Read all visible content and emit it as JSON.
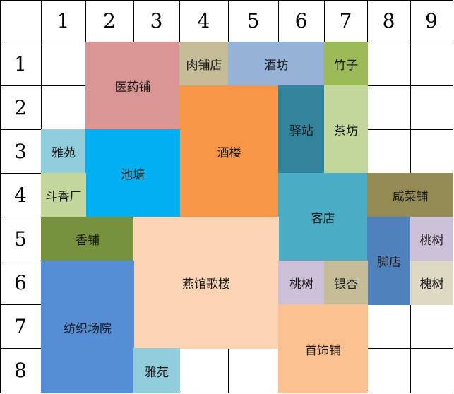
{
  "columns": [
    "1",
    "2",
    "3",
    "4",
    "5",
    "6",
    "7",
    "8",
    "9"
  ],
  "rows": [
    "1",
    "2",
    "3",
    "4",
    "5",
    "6",
    "7",
    "8"
  ],
  "cells": [
    {
      "id": "yiyaopu",
      "label": "医药铺",
      "color": "#d99694"
    },
    {
      "id": "roupudian",
      "label": "肉铺店",
      "color": "#c4bd97"
    },
    {
      "id": "jiufang",
      "label": "酒坊",
      "color": "#95b3d7"
    },
    {
      "id": "zhuzi",
      "label": "竹子",
      "color": "#9bbb59"
    },
    {
      "id": "jiulou",
      "label": "酒楼",
      "color": "#f79646"
    },
    {
      "id": "yizhan",
      "label": "驿站",
      "color": "#31849b"
    },
    {
      "id": "chafang",
      "label": "茶坊",
      "color": "#c3d69b"
    },
    {
      "id": "yayuan-1",
      "label": "雅苑",
      "color": "#92cddc"
    },
    {
      "id": "chitang",
      "label": "池塘",
      "color": "#00b0f0"
    },
    {
      "id": "douxiangchang",
      "label": "斗香厂",
      "color": "#c3d69b"
    },
    {
      "id": "kedian",
      "label": "客店",
      "color": "#4bacc6"
    },
    {
      "id": "xiancaipu",
      "label": "咸菜铺",
      "color": "#948a54"
    },
    {
      "id": "xiangpu",
      "label": "香铺",
      "color": "#76923c"
    },
    {
      "id": "yanguangelou",
      "label": "燕馆歌楼",
      "color": "#fbd4b4"
    },
    {
      "id": "jiaodian",
      "label": "脚店",
      "color": "#4f81bd"
    },
    {
      "id": "taoshu-1",
      "label": "桃树",
      "color": "#ccc1d9"
    },
    {
      "id": "taoshu-2",
      "label": "桃树",
      "color": "#ccc1d9"
    },
    {
      "id": "yinxing",
      "label": "银杏",
      "color": "#c4bd97"
    },
    {
      "id": "huaishu",
      "label": "槐树",
      "color": "#ddd9c3"
    },
    {
      "id": "fangzhichangyuan",
      "label": "纺织场院",
      "color": "#558ed5"
    },
    {
      "id": "shoushipu",
      "label": "首饰铺",
      "color": "#fac090"
    },
    {
      "id": "yayuan-2",
      "label": "雅苑",
      "color": "#92cddc"
    }
  ]
}
